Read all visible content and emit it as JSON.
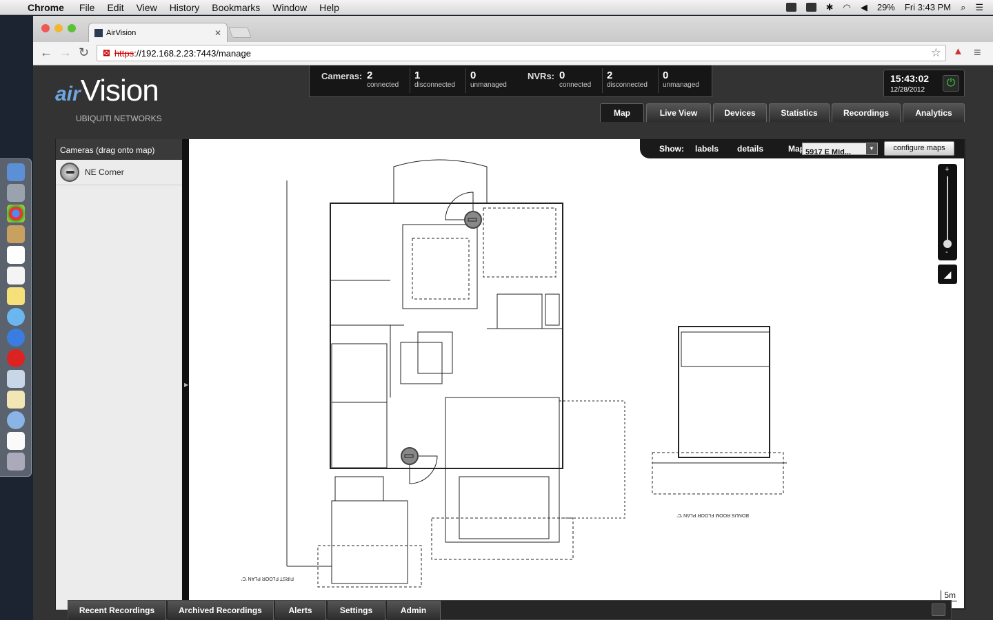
{
  "menubar": {
    "app_name": "Chrome",
    "items": [
      "File",
      "Edit",
      "View",
      "History",
      "Bookmarks",
      "Window",
      "Help"
    ],
    "battery": "29%",
    "clock": "Fri 3:43 PM"
  },
  "browser": {
    "tab_title": "AirVision",
    "url_scheme": "https",
    "url_rest": "://192.168.2.23:7443/manage"
  },
  "header": {
    "logo_air": "air",
    "logo_vision": "Vision",
    "logo_company": "UBIQUITI NETWORKS",
    "cameras_label": "Cameras:",
    "nvrs_label": "NVRs:",
    "camera_stats": [
      {
        "value": "2",
        "label": "connected"
      },
      {
        "value": "1",
        "label": "disconnected"
      },
      {
        "value": "0",
        "label": "unmanaged"
      }
    ],
    "nvr_stats": [
      {
        "value": "0",
        "label": "connected"
      },
      {
        "value": "2",
        "label": "disconnected"
      },
      {
        "value": "0",
        "label": "unmanaged"
      }
    ],
    "time": "15:43:02",
    "date": "12/28/2012"
  },
  "nav_tabs": [
    "Map",
    "Live View",
    "Devices",
    "Statistics",
    "Recordings",
    "Analytics"
  ],
  "active_tab": "Map",
  "sidebar": {
    "header": "Cameras (drag onto map)",
    "cameras": [
      "NE Corner"
    ]
  },
  "mapbar": {
    "show_label": "Show:",
    "labels_toggle": "labels",
    "details_toggle": "details",
    "map_label": "Map:",
    "map_selected": "5917 E Mid...",
    "configure_label": "configure maps"
  },
  "map": {
    "zoom_plus": "+",
    "zoom_minus": "-",
    "scale_label": "5m",
    "plan_caption_1": "FIRST FLOOR PLAN 'C'",
    "plan_caption_2": "BONUS ROOM FLOOR PLAN 'C'"
  },
  "bottom_tabs": [
    "Recent Recordings",
    "Archived Recordings",
    "Alerts",
    "Settings",
    "Admin"
  ],
  "colors": {
    "accent_green": "#33cc33",
    "camera_fov": "#22dd22"
  }
}
